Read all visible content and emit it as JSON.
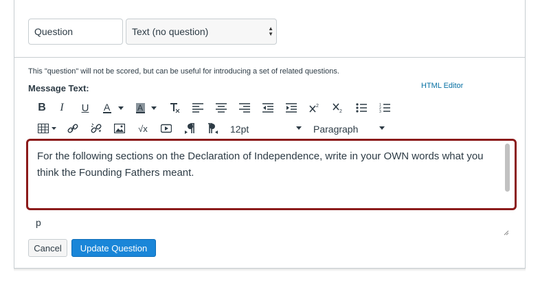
{
  "form": {
    "title_value": "Question",
    "type_selected": "Text (no question)",
    "note": "This \"question\" will not be scored, but can be useful for introducing a set of related questions.",
    "message_label": "Message Text:",
    "html_editor_link": "HTML Editor"
  },
  "toolbar": {
    "row1": [
      "bold-icon",
      "italic-icon",
      "underline-icon",
      "text-color-icon",
      "background-color-icon",
      "clear-formatting-icon",
      "align-left-icon",
      "align-center-icon",
      "align-right-icon",
      "outdent-icon",
      "indent-icon",
      "superscript-icon",
      "subscript-icon",
      "bullet-list-icon",
      "numbered-list-icon"
    ],
    "row2": [
      "table-icon",
      "link-icon",
      "unlink-icon",
      "image-icon",
      "equation-icon",
      "media-icon",
      "ltr-icon",
      "rtl-icon"
    ],
    "font_size": "12pt",
    "block_format": "Paragraph"
  },
  "editor": {
    "content": "For the following sections on the Declaration of Independence, write in your OWN words what you think the Founding Fathers meant.",
    "path": "p"
  },
  "actions": {
    "cancel_label": "Cancel",
    "update_label": "Update Question"
  },
  "colors": {
    "focus_border": "#8b1a1a",
    "primary_button": "#1a86d8",
    "link": "#0770a3"
  }
}
